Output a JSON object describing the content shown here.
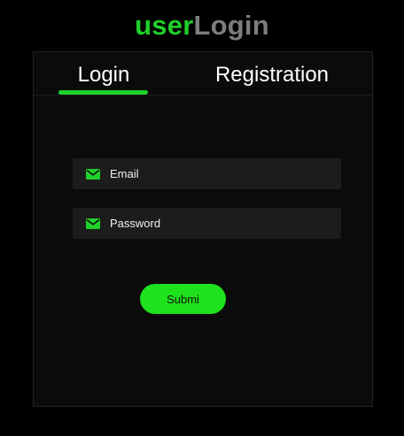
{
  "app_title": {
    "part_user": "user",
    "part_login": "Login"
  },
  "tabs": [
    {
      "label": "Login",
      "active": true
    },
    {
      "label": "Registration",
      "active": false
    }
  ],
  "form": {
    "email": {
      "placeholder": "Email",
      "value": "",
      "icon": "envelope-icon"
    },
    "password": {
      "placeholder": "Password",
      "value": "",
      "icon": "envelope-icon"
    },
    "submit_label": "Submi"
  },
  "colors": {
    "accent": "#1fd12a",
    "title_secondary": "#7d7d7d",
    "background": "#000000",
    "card": "#0b0b0b",
    "field": "#1c1c1c",
    "button": "#1ee21c"
  }
}
